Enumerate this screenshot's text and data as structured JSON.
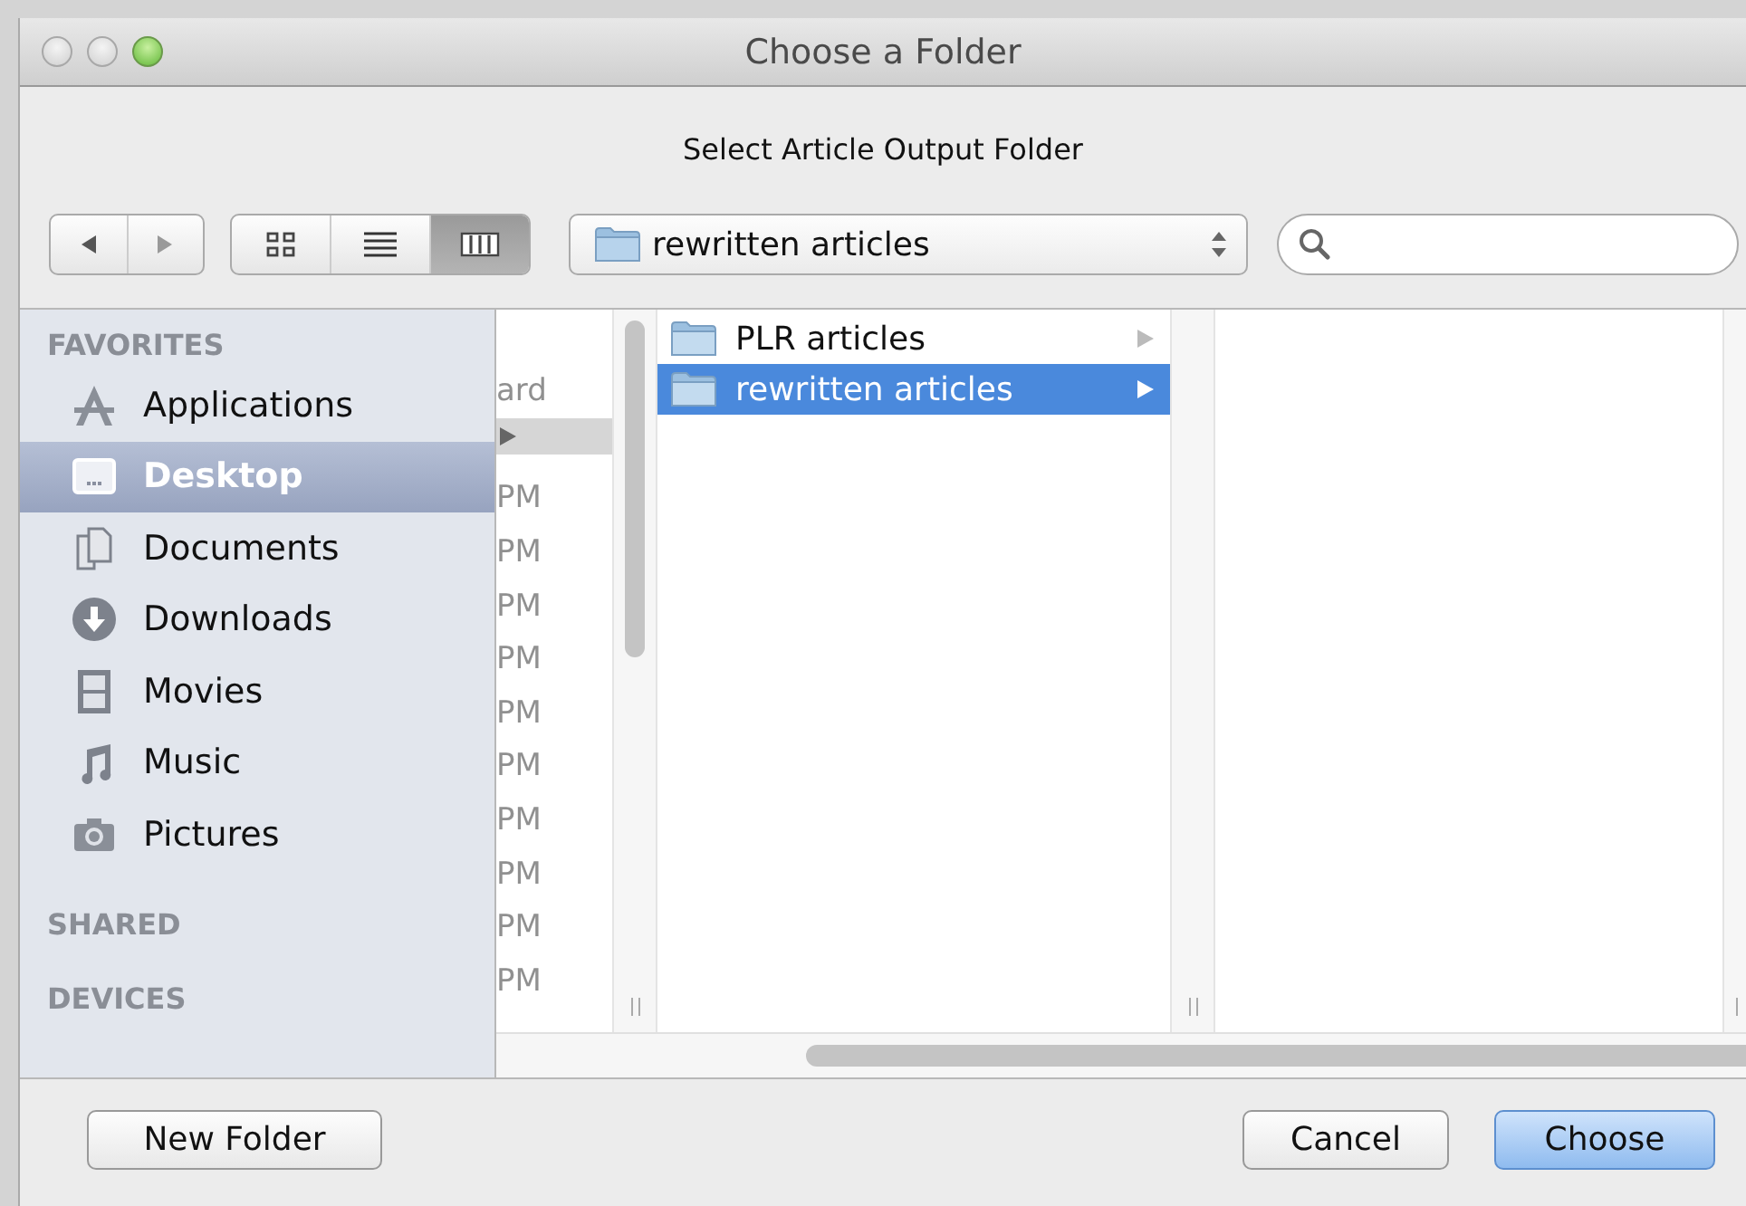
{
  "window": {
    "title": "Choose a Folder"
  },
  "prompt": "Select Article Output Folder",
  "toolbar": {
    "view_modes": [
      {
        "kind": "icons",
        "selected": false
      },
      {
        "kind": "list",
        "selected": false
      },
      {
        "kind": "columns",
        "selected": true
      }
    ],
    "path_popup": "rewritten articles"
  },
  "sidebar": {
    "sections": [
      {
        "heading": "FAVORITES",
        "items": [
          {
            "label": "Applications",
            "kind": "applications",
            "selected": false
          },
          {
            "label": "Desktop",
            "kind": "desktop",
            "selected": true
          },
          {
            "label": "Documents",
            "kind": "documents",
            "selected": false
          },
          {
            "label": "Downloads",
            "kind": "downloads",
            "selected": false
          },
          {
            "label": "Movies",
            "kind": "movies",
            "selected": false
          },
          {
            "label": "Music",
            "kind": "music",
            "selected": false
          },
          {
            "label": "Pictures",
            "kind": "pictures",
            "selected": false
          }
        ]
      },
      {
        "heading": "SHARED"
      },
      {
        "heading": "DEVICES"
      }
    ]
  },
  "column_1": {
    "rows": [
      {
        "text": "ard",
        "selected": false
      },
      {
        "selected": true
      },
      {
        "text": "PM",
        "selected": false
      },
      {
        "text": "PM",
        "selected": false
      },
      {
        "text": "PM",
        "selected": false
      },
      {
        "text": "PM",
        "selected": false
      },
      {
        "text": "PM",
        "selected": false
      },
      {
        "text": "PM",
        "selected": false
      },
      {
        "text": "PM",
        "selected": false
      },
      {
        "text": "PM",
        "selected": false
      },
      {
        "text": "PM",
        "selected": false
      },
      {
        "text": "PM",
        "selected": false
      }
    ]
  },
  "column_2": {
    "rows": [
      {
        "name": "PLR articles",
        "selected": false
      },
      {
        "name": "rewritten articles",
        "selected": true
      }
    ]
  },
  "buttons": [
    {
      "label": "New Folder",
      "default": false
    },
    {
      "label": "Cancel",
      "default": false
    },
    {
      "label": "Choose",
      "default": true
    }
  ]
}
